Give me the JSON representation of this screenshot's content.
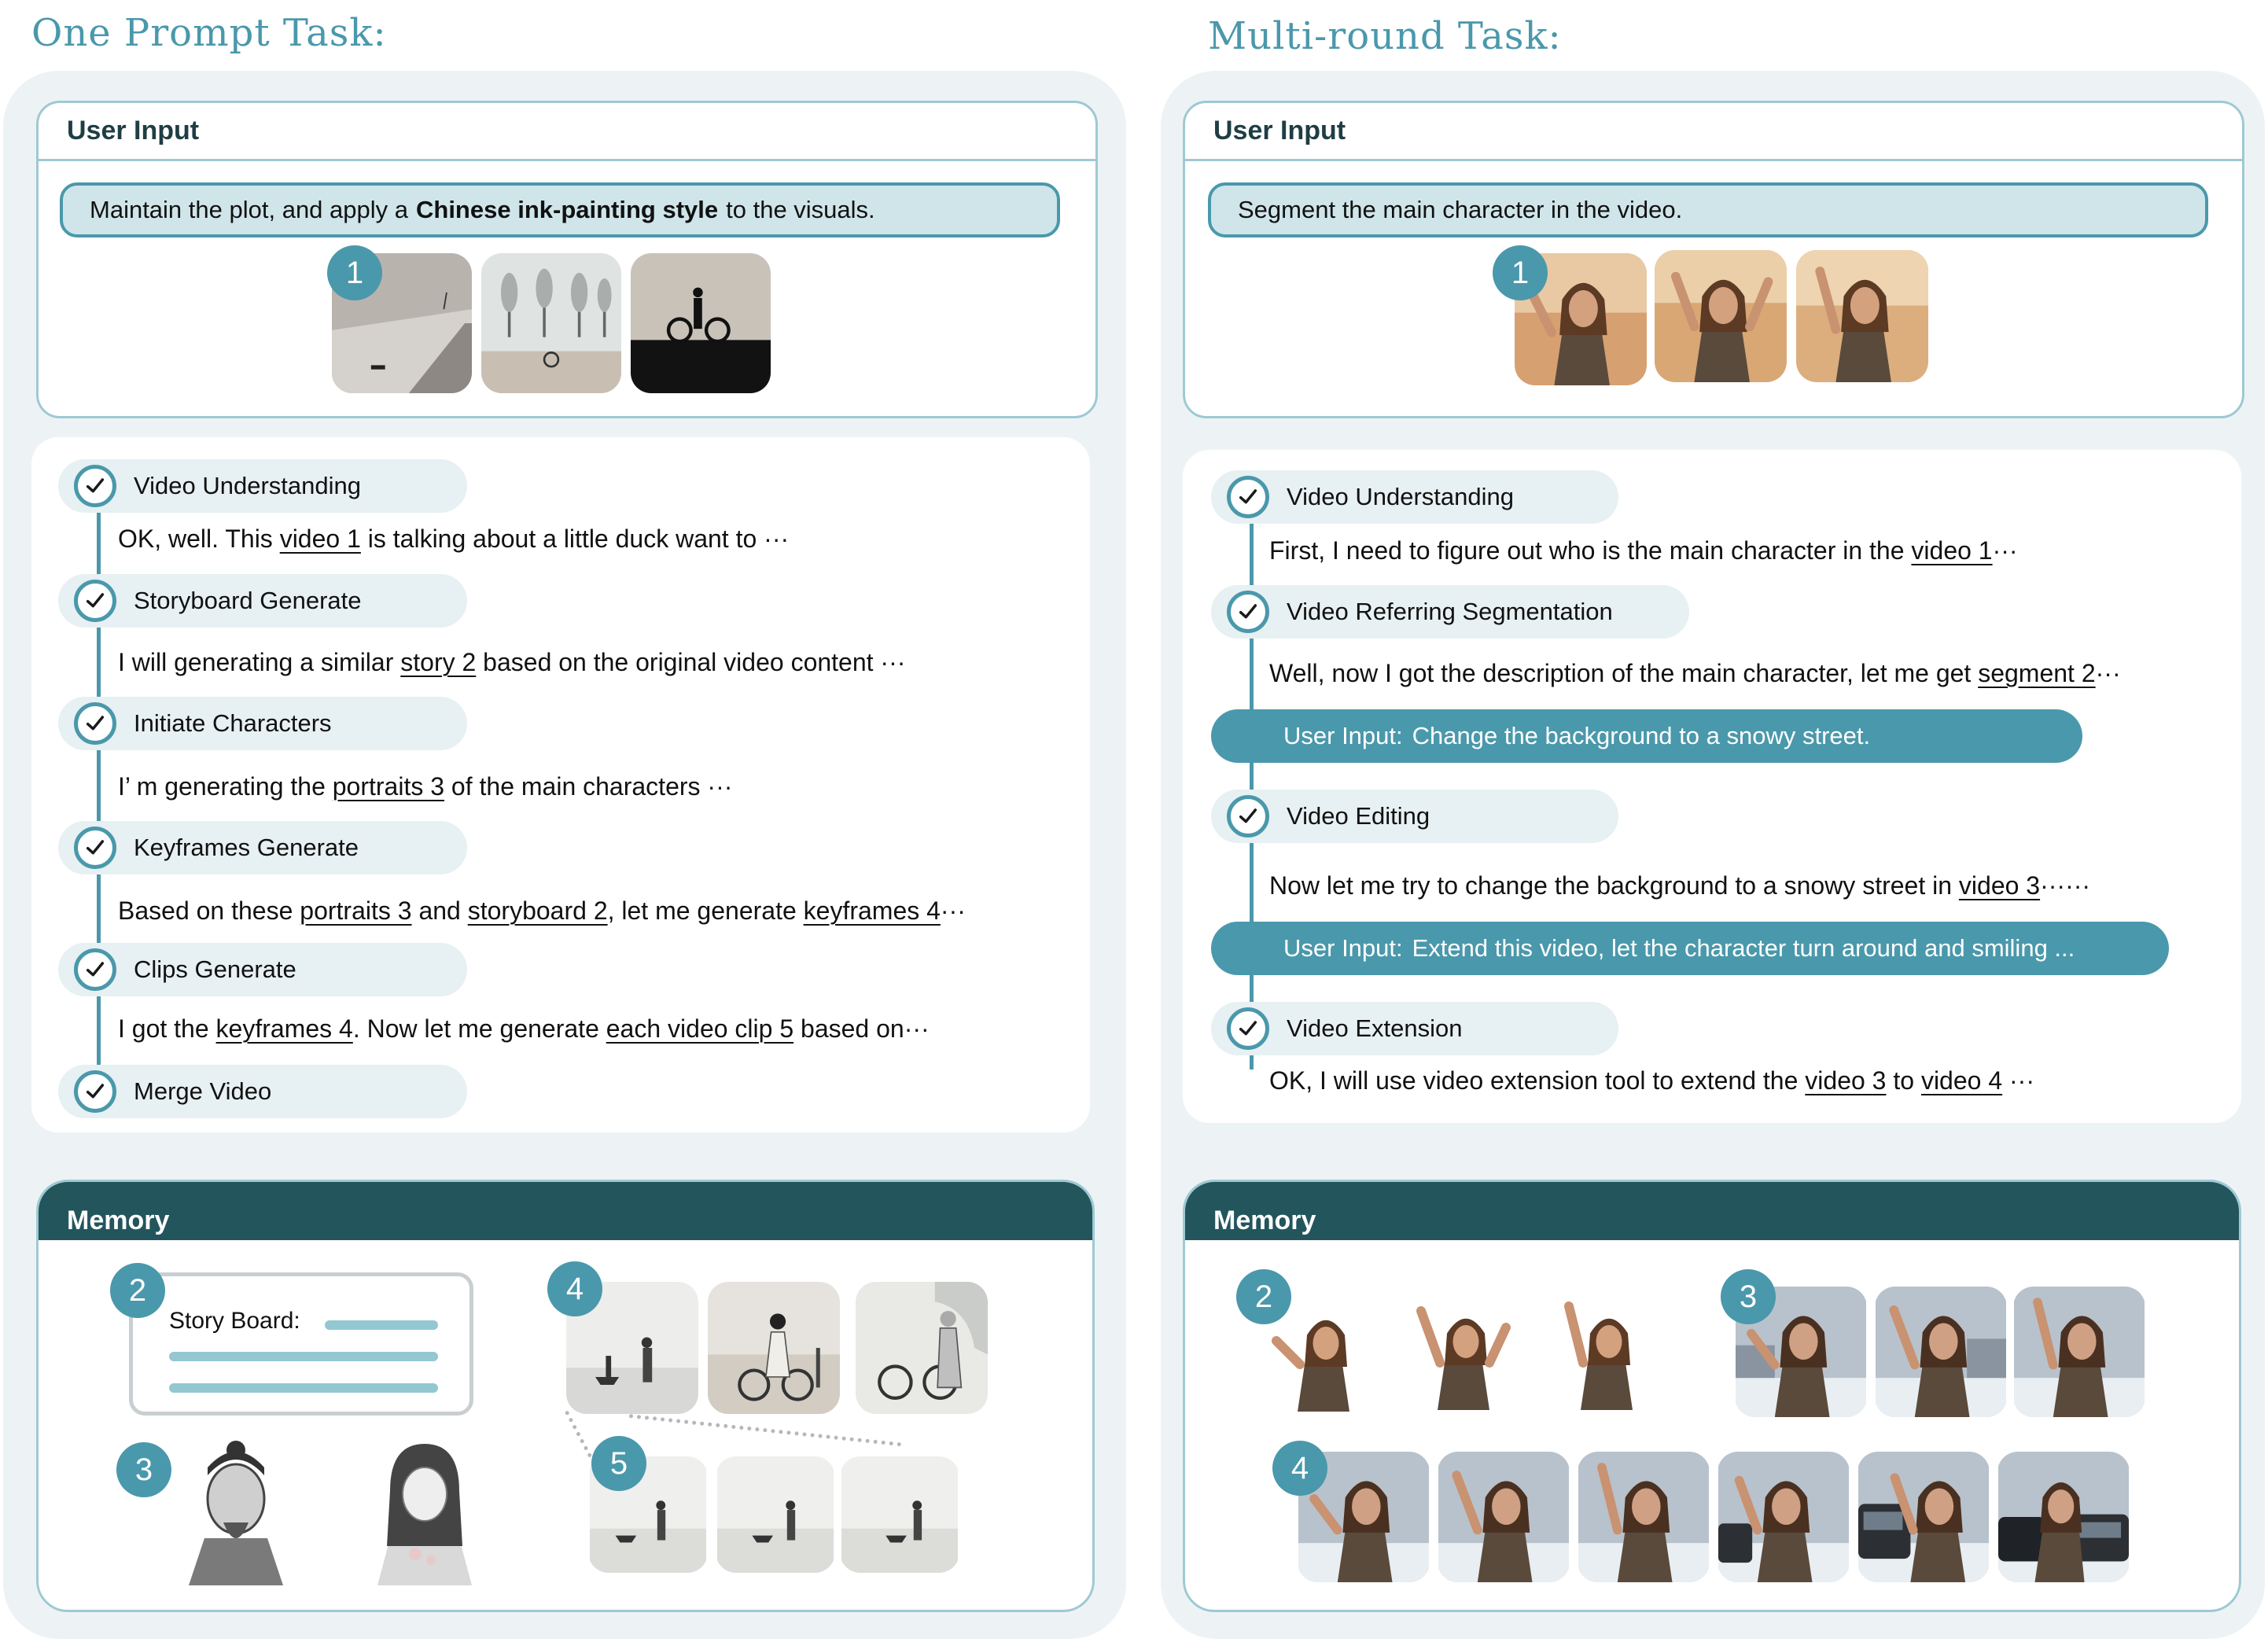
{
  "left": {
    "title": "One Prompt Task:",
    "user_input_header": "User Input",
    "prompt": {
      "before": "Maintain the plot, and apply a",
      "bold": "Chinese ink-painting style",
      "after": "to the visuals."
    },
    "input_badge": "1",
    "steps": [
      {
        "label": "Video Understanding",
        "line": [
          {
            "t": "OK, well. This "
          },
          {
            "t": "video 1",
            "link": true
          },
          {
            "t": " is talking about a little duck want to ···"
          }
        ]
      },
      {
        "label": "Storyboard Generate",
        "line": [
          {
            "t": "I will generating a similar "
          },
          {
            "t": "story 2",
            "link": true
          },
          {
            "t": " based on the original video content ···"
          }
        ]
      },
      {
        "label": "Initiate Characters",
        "line": [
          {
            "t": "I’ m generating the "
          },
          {
            "t": "portraits 3",
            "link": true
          },
          {
            "t": " of the main characters ···"
          }
        ]
      },
      {
        "label": "Keyframes Generate",
        "line": [
          {
            "t": "Based on these "
          },
          {
            "t": "portraits 3",
            "link": true
          },
          {
            "t": " and "
          },
          {
            "t": "storyboard 2",
            "link": true
          },
          {
            "t": ", let me generate "
          },
          {
            "t": "keyframes 4",
            "link": true
          },
          {
            "t": "···"
          }
        ]
      },
      {
        "label": "Clips Generate",
        "line": [
          {
            "t": "I got the "
          },
          {
            "t": "keyframes 4",
            "link": true
          },
          {
            "t": ". Now let me generate "
          },
          {
            "t": "each video clip 5",
            "link": true
          },
          {
            "t": " based on···"
          }
        ]
      },
      {
        "label": "Merge Video",
        "line": []
      }
    ],
    "memory_header": "Memory",
    "memory": {
      "badge_story": "2",
      "story_label": "Story Board:",
      "badge_portraits": "3",
      "badge_keyframes": "4",
      "badge_clips": "5"
    }
  },
  "right": {
    "title": "Multi-round Task:",
    "user_input_header": "User Input",
    "prompt": "Segment the main character in the video.",
    "input_badge": "1",
    "steps": [
      {
        "label": "Video Understanding",
        "line": [
          {
            "t": "First, I need to figure out who is the main character in the "
          },
          {
            "t": "video 1",
            "link": true
          },
          {
            "t": "···"
          }
        ]
      },
      {
        "label": "Video Referring Segmentation",
        "line": [
          {
            "t": "Well, now I got the description of the main character, let me get "
          },
          {
            "t": "segment 2",
            "link": true
          },
          {
            "t": "···"
          }
        ]
      },
      {
        "label": "Video Editing",
        "line": [
          {
            "t": "Now let me try to change the background to a snowy street in "
          },
          {
            "t": "video 3",
            "link": true
          },
          {
            "t": "······"
          }
        ]
      },
      {
        "label": "Video Extension",
        "line": [
          {
            "t": "OK, I will use video extension tool to extend the "
          },
          {
            "t": "video 3",
            "link": true
          },
          {
            "t": " to "
          },
          {
            "t": "video 4",
            "link": true
          },
          {
            "t": " ···"
          }
        ]
      }
    ],
    "user_bars": [
      {
        "label": "User Input:",
        "text": "Change the background to a snowy street."
      },
      {
        "label": "User Input:",
        "text": "Extend this video, let the character turn around and smiling ..."
      }
    ],
    "memory_header": "Memory",
    "memory": {
      "badge_segment": "2",
      "badge_edit": "3",
      "badge_extend": "4"
    }
  },
  "colors": {
    "accent": "#4a98ab",
    "memory_header": "#23555d",
    "panel": "#edf3f5",
    "pill": "#e7f0f2",
    "prompt_fill": "#cfe5ea"
  }
}
